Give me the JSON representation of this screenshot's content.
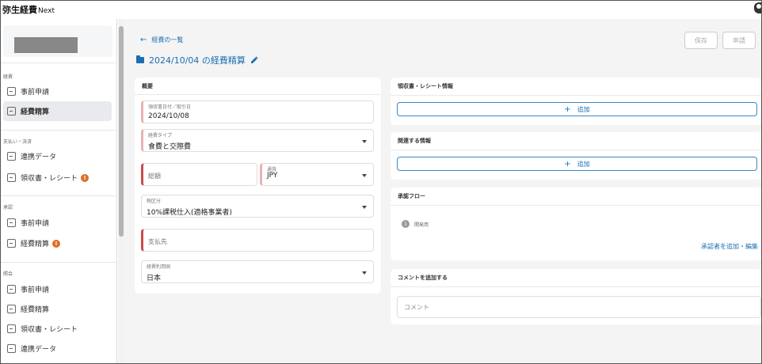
{
  "app": {
    "brand": "弥生経費",
    "brand_suffix": "Next"
  },
  "sidebar": {
    "sections": [
      {
        "label": "経費",
        "items": [
          {
            "label": "事前申請"
          },
          {
            "label": "経費精算",
            "active": true
          }
        ]
      },
      {
        "label": "支払い・決済",
        "items": [
          {
            "label": "連携データ"
          },
          {
            "label": "領収書・レシート",
            "badge": "!"
          }
        ]
      },
      {
        "label": "承認",
        "items": [
          {
            "label": "事前申請"
          },
          {
            "label": "経費精算",
            "badge": "!"
          }
        ]
      },
      {
        "label": "照会",
        "items": [
          {
            "label": "事前申請"
          },
          {
            "label": "経費精算"
          },
          {
            "label": "領収書・レシート"
          },
          {
            "label": "連携データ"
          }
        ]
      }
    ]
  },
  "header": {
    "back_label": "経費の一覧",
    "title": "2024/10/04 の経費精算",
    "save_label": "保存",
    "apply_label": "申請"
  },
  "summary": {
    "title": "概要",
    "receipt_date_label": "領収書日付／取引日",
    "receipt_date_value": "2024/10/08",
    "expense_type_label": "経費タイプ",
    "expense_type_value": "食費と交際費",
    "amount_placeholder": "総額",
    "currency_label": "通貨",
    "currency_value": "JPY",
    "tax_label": "税区分",
    "tax_value": "10%課税仕入(適格事業者)",
    "payee_placeholder": "支払先",
    "usage_country_label": "経費利用国",
    "usage_country_value": "日本"
  },
  "receipt_info": {
    "title": "領収書・レシート情報",
    "add_label": "追加"
  },
  "related_info": {
    "title": "関連する情報",
    "add_label": "追加"
  },
  "approval_flow": {
    "title": "承認フロー",
    "step_number": "1",
    "step_label": "開発用",
    "approver_link": "承認者を追加・編集"
  },
  "comment": {
    "title": "コメントを追加する",
    "placeholder": "コメント"
  },
  "colors": {
    "accent_blue": "#1a6fb3",
    "badge_orange": "#e06d23",
    "required_red": "#c84c4c"
  }
}
